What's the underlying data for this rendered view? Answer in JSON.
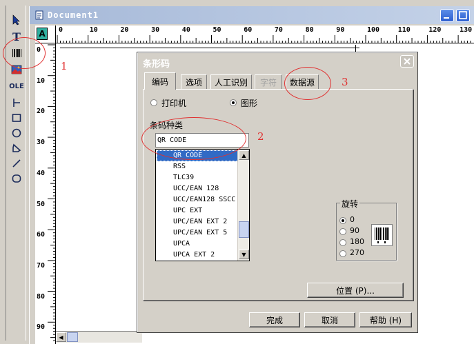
{
  "window": {
    "title": "Document1"
  },
  "toolbox": {
    "tools": [
      {
        "name": "select",
        "icon": "arrow-pointer-icon"
      },
      {
        "name": "text",
        "label": "T",
        "icon": "text-tool-icon"
      },
      {
        "name": "barcode",
        "icon": "barcode-icon"
      },
      {
        "name": "image",
        "icon": "image-icon"
      },
      {
        "name": "ole",
        "label": "OLE",
        "icon": "ole-icon"
      },
      {
        "name": "line-marker",
        "icon": "line-marker-icon"
      },
      {
        "name": "rectangle",
        "icon": "rectangle-icon"
      },
      {
        "name": "ellipse",
        "icon": "ellipse-icon"
      },
      {
        "name": "polygon",
        "icon": "polygon-icon"
      },
      {
        "name": "line",
        "icon": "diagonal-line-icon"
      },
      {
        "name": "rounded-rectangle",
        "icon": "rounded-rectangle-icon"
      }
    ]
  },
  "ruler": {
    "corner_label": "A",
    "h_labels": [
      "0",
      "10",
      "20",
      "30",
      "40",
      "50",
      "60",
      "70",
      "80",
      "90",
      "100",
      "110",
      "120",
      "130"
    ],
    "v_labels": [
      "0",
      "10",
      "20",
      "30",
      "40",
      "50",
      "60",
      "70",
      "80",
      "90"
    ]
  },
  "dialog": {
    "title": "条形码",
    "close_label": "X",
    "tabs": [
      {
        "label": "编码",
        "active": true,
        "disabled": false
      },
      {
        "label": "选项",
        "active": false,
        "disabled": false
      },
      {
        "label": "人工识别",
        "active": false,
        "disabled": false
      },
      {
        "label": "字符",
        "active": false,
        "disabled": true
      },
      {
        "label": "数据源",
        "active": false,
        "disabled": false
      }
    ],
    "output": {
      "printer_label": "打印机",
      "graphic_label": "图形",
      "selected": "图形"
    },
    "type_section_label": "条码种类",
    "type_value": "QR CODE",
    "type_options": [
      "QR CODE",
      "RSS",
      "TLC39",
      "UCC/EAN 128",
      "UCC/EAN128 SSCC",
      "UPC EXT",
      "UPC/EAN EXT 2",
      "UPC/EAN EXT 5",
      "UPCA",
      "UPCA  EXT 2"
    ],
    "type_selected": "QR CODE",
    "rotation": {
      "label": "旋转",
      "options": [
        "0",
        "90",
        "180",
        "270"
      ],
      "selected": "0"
    },
    "position_button": "位置 (P)...",
    "ok_button": "完成",
    "cancel_button": "取消",
    "help_button": "帮助 (H)"
  },
  "annotations": {
    "n1": "1",
    "n2": "2",
    "n3": "3"
  },
  "colors": {
    "annotation": "#e03030",
    "selection": "#316ac5",
    "xp_title": "#a6b9d8"
  }
}
